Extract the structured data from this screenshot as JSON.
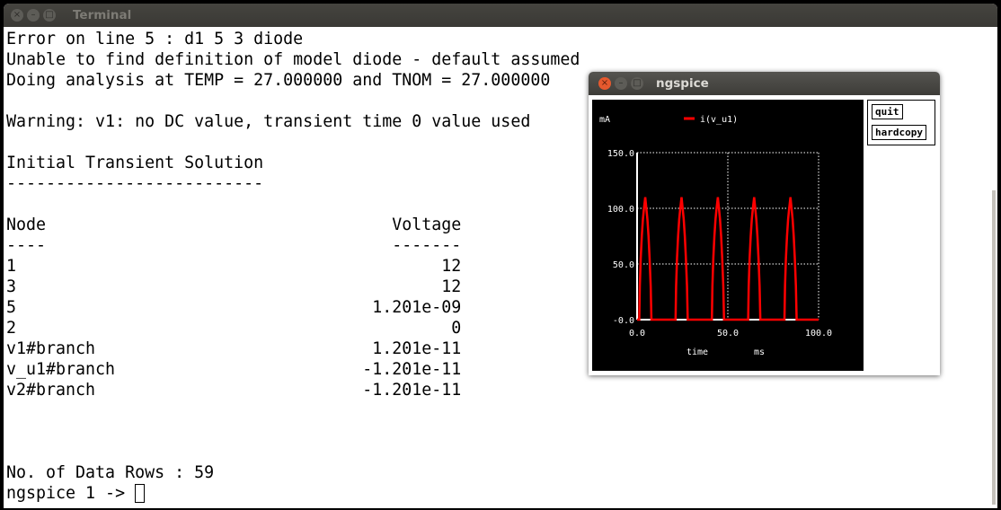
{
  "terminal": {
    "title": "Terminal",
    "lines": [
      "Error on line 5 : d1 5 3 diode",
      "Unable to find definition of model diode - default assumed",
      "Doing analysis at TEMP = 27.000000 and TNOM = 27.000000",
      "",
      "Warning: v1: no DC value, transient time 0 value used",
      "",
      "Initial Transient Solution",
      "--------------------------",
      ""
    ],
    "table": {
      "headers": [
        "Node",
        "Voltage"
      ],
      "separators": [
        "----",
        "-------"
      ],
      "rows": [
        [
          "1",
          "12"
        ],
        [
          "3",
          "12"
        ],
        [
          "5",
          "1.201e-09"
        ],
        [
          "2",
          "0"
        ],
        [
          "v1#branch",
          "1.201e-11"
        ],
        [
          "v_u1#branch",
          "-1.201e-11"
        ],
        [
          "v2#branch",
          "-1.201e-11"
        ]
      ]
    },
    "data_rows_line": "No. of Data Rows : 59",
    "prompt": "ngspice 1 -> "
  },
  "ngspice_window": {
    "title": "ngspice",
    "buttons": {
      "quit": "quit",
      "hardcopy": "hardcopy"
    }
  },
  "chart_data": {
    "type": "line",
    "ylabel": "mA",
    "xlabel": "time",
    "xunit": "ms",
    "xlim": [
      0,
      100
    ],
    "ylim": [
      0,
      150
    ],
    "xticks": [
      "0.0",
      "50.0",
      "100.0"
    ],
    "yticks": [
      "-0.0",
      "50.0",
      "100.0",
      "150.0"
    ],
    "grid": true,
    "legend": "top",
    "background": "#000000",
    "series": [
      {
        "name": "i(v_u1)",
        "color": "#ff0000",
        "x": [
          0,
          1.2,
          1.5,
          2,
          2.6,
          3.2,
          3.8,
          4.5,
          5.1,
          5.7,
          6.3,
          6.9,
          7.5,
          7.9,
          21.2,
          21.5,
          22,
          22.6,
          23.2,
          23.8,
          24.5,
          25.1,
          25.7,
          26.3,
          26.9,
          27.5,
          27.9,
          41.2,
          41.5,
          42,
          42.6,
          43.2,
          43.8,
          44.5,
          45.1,
          45.7,
          46.3,
          46.9,
          47.5,
          47.9,
          61.2,
          61.5,
          62,
          62.6,
          63.2,
          63.8,
          64.5,
          65.1,
          65.7,
          66.3,
          66.9,
          67.5,
          67.9,
          81.2,
          81.5,
          82,
          82.6,
          83.2,
          83.8,
          84.5,
          85.1,
          85.7,
          86.3,
          86.9,
          87.5,
          87.9,
          100
        ],
        "y": [
          0,
          0,
          30,
          55,
          75,
          90,
          100,
          110,
          100,
          90,
          75,
          55,
          30,
          0,
          0,
          30,
          55,
          75,
          90,
          100,
          110,
          100,
          90,
          75,
          55,
          30,
          0,
          0,
          30,
          55,
          75,
          90,
          100,
          110,
          100,
          90,
          75,
          55,
          30,
          0,
          0,
          30,
          55,
          75,
          90,
          100,
          110,
          100,
          90,
          75,
          55,
          30,
          0,
          0,
          30,
          55,
          75,
          90,
          100,
          110,
          100,
          90,
          75,
          55,
          30,
          0,
          0
        ]
      }
    ]
  }
}
